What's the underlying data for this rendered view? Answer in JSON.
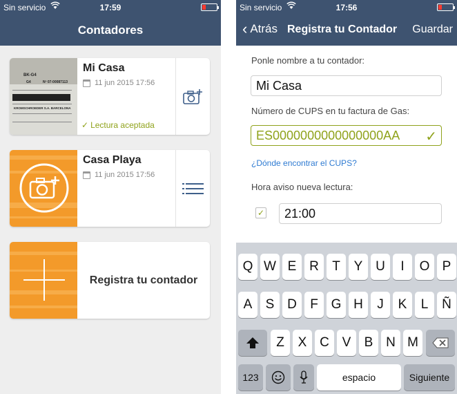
{
  "status_bar_left": {
    "carrier": "Sin servicio",
    "time": "17:59"
  },
  "status_bar_right": {
    "carrier": "Sin servicio",
    "time": "17:56"
  },
  "contadores": {
    "title": "Contadores",
    "meters": [
      {
        "name": "Mi Casa",
        "date": "11 jun 2015 17:56",
        "status": "Lectura aceptada",
        "photo_text": [
          "BK-G4",
          "G4",
          "Nº 07-00087113",
          "KROMSCHROEDER  S.A.  BARCELONA"
        ],
        "action_icon": "camera-plus-icon"
      },
      {
        "name": "Casa Playa",
        "date": "11 jun 2015 17:56",
        "action_icon": "list-icon",
        "photo_icon": "camera-plus-icon"
      }
    ],
    "register_label": "Registra tu contador"
  },
  "registro": {
    "back_label": "Atrás",
    "title": "Registra tu Contador",
    "save_label": "Guardar",
    "name_label": "Ponle nombre a tu contador:",
    "name_value": "Mi Casa",
    "cups_label": "Número de CUPS en tu factura de Gas:",
    "cups_value": "ES0000000000000000AA",
    "cups_link": "¿Dónde encontrar el CUPS?",
    "reminder_label": "Hora aviso nueva lectura:",
    "reminder_checked": true,
    "reminder_time": "21:00"
  },
  "keyboard": {
    "row1": [
      "Q",
      "W",
      "E",
      "R",
      "T",
      "Y",
      "U",
      "I",
      "O",
      "P"
    ],
    "row2": [
      "A",
      "S",
      "D",
      "F",
      "G",
      "H",
      "J",
      "K",
      "L",
      "Ñ"
    ],
    "row3": [
      "Z",
      "X",
      "C",
      "V",
      "B",
      "N",
      "M"
    ],
    "numbers_label": "123",
    "space_label": "espacio",
    "return_label": "Siguiente"
  },
  "colors": {
    "navbar": "#3e5370",
    "accent_green": "#8fa21b",
    "accent_orange": "#f39a2a",
    "link_blue": "#2f7bd2",
    "icon_blue": "#3e5f8a"
  }
}
